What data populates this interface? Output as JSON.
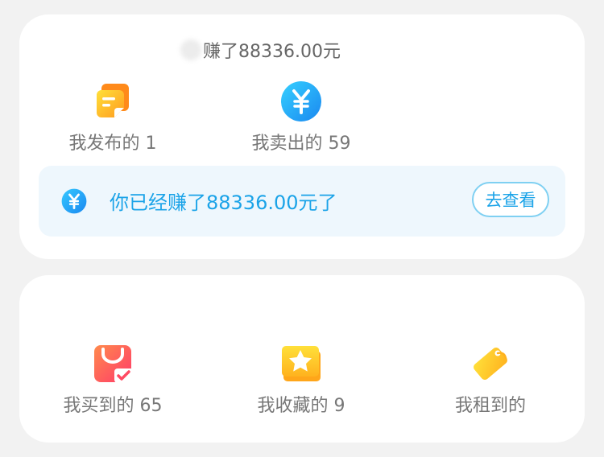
{
  "summary": {
    "earned_label": "赚了88336.00元"
  },
  "stats_top": [
    {
      "label": "我发布的",
      "count": "1",
      "icon": "note-icon"
    },
    {
      "label": "我卖出的",
      "count": "59",
      "icon": "yen-coin-icon"
    }
  ],
  "banner": {
    "message": "你已经赚了88336.00元了",
    "button_label": "去查看",
    "icon": "yen-coin-icon"
  },
  "stats_bottom": [
    {
      "label": "我买到的",
      "count": "65",
      "icon": "shopping-bag-icon"
    },
    {
      "label": "我收藏的",
      "count": "9",
      "icon": "star-icon"
    },
    {
      "label": "我租到的",
      "count": "",
      "icon": "tag-icon"
    }
  ],
  "colors": {
    "background": "#f2f2f2",
    "card": "#ffffff",
    "accent_blue": "#1aa3e8",
    "banner_bg": "#eef7fd",
    "label_gray": "#777777"
  }
}
